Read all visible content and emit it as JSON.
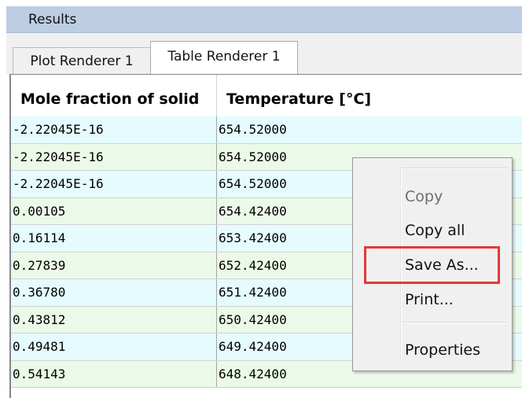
{
  "panel": {
    "title": "Results"
  },
  "tabs": [
    {
      "label": "Plot Renderer 1",
      "active": false
    },
    {
      "label": "Table Renderer 1",
      "active": true
    }
  ],
  "table": {
    "headers": [
      "Mole fraction of solid",
      "Temperature [°C]"
    ],
    "rows": [
      [
        "-2.22045E-16",
        "654.52000"
      ],
      [
        "-2.22045E-16",
        "654.52000"
      ],
      [
        "-2.22045E-16",
        "654.52000"
      ],
      [
        "0.00105",
        "654.42400"
      ],
      [
        "0.16114",
        "653.42400"
      ],
      [
        "0.27839",
        "652.42400"
      ],
      [
        "0.36780",
        "651.42400"
      ],
      [
        "0.43812",
        "650.42400"
      ],
      [
        "0.49481",
        "649.42400"
      ],
      [
        "0.54143",
        "648.42400"
      ]
    ]
  },
  "context_menu": {
    "items": [
      {
        "label": "Copy",
        "enabled": false
      },
      {
        "label": "Copy all",
        "enabled": true
      },
      {
        "label": "Save As...",
        "enabled": true,
        "highlighted": true
      },
      {
        "label": "Print...",
        "enabled": true
      },
      {
        "label": "Properties",
        "enabled": true
      }
    ]
  },
  "colors": {
    "header_bar": "#bccde4",
    "row_odd": "#e5fbfe",
    "row_even": "#ebfae8",
    "highlight_border": "#e33a3a"
  }
}
